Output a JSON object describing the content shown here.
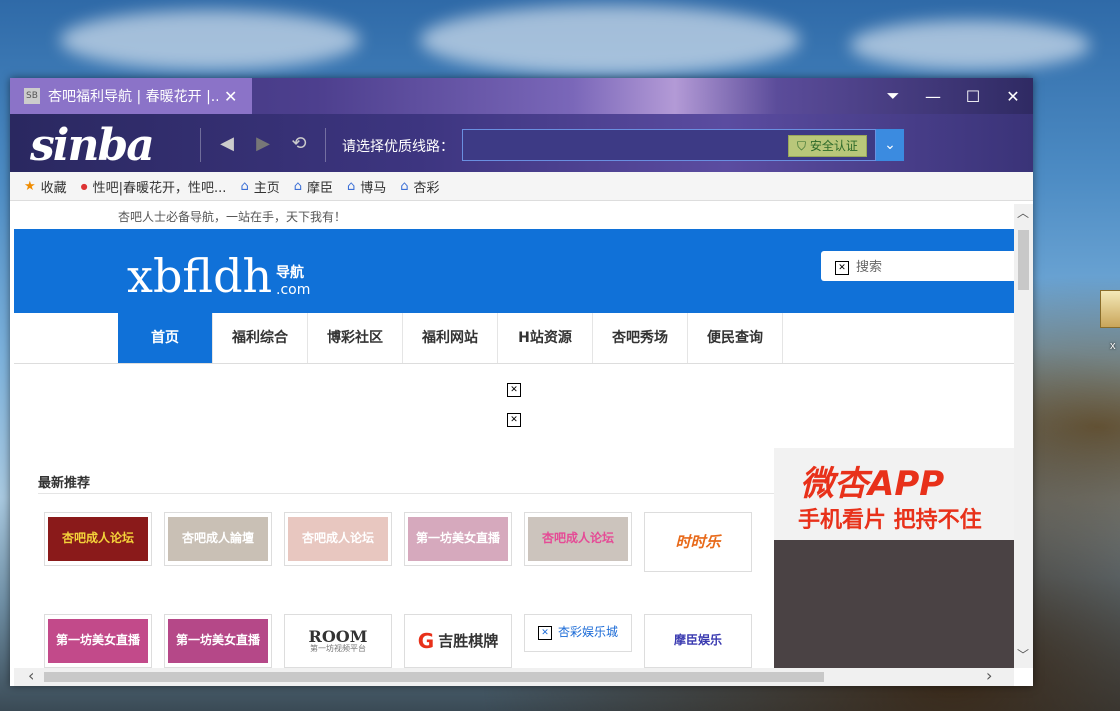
{
  "desktop": {
    "icon_label": "x"
  },
  "tab": {
    "favicon": "SB",
    "title": "杏吧福利导航 | 春暖花开 |...",
    "close": "✕"
  },
  "window_controls": {
    "menu": "⏷",
    "minimize": "—",
    "maximize": "☐",
    "close": "✕"
  },
  "toolbar": {
    "logo": "sinba",
    "back": "◀",
    "forward": "▶",
    "refresh": "⟲",
    "route_label": "请选择优质线路：",
    "route_value": "",
    "secure_label": "安全认证",
    "dropdown": "⌄"
  },
  "bookmarks": [
    {
      "label": "收藏",
      "icon": "star-icon"
    },
    {
      "label": "性吧|春暖花开，性吧...",
      "icon": "site-favicon"
    },
    {
      "label": "主页",
      "icon": "home-icon"
    },
    {
      "label": "摩臣",
      "icon": "home-icon"
    },
    {
      "label": "博马",
      "icon": "home-icon"
    },
    {
      "label": "杏彩",
      "icon": "home-icon"
    }
  ],
  "page": {
    "slogan": "杏吧人士必备导航，一站在手，天下我有！",
    "logo": "xbfldh",
    "logo_sub1": "导航",
    "logo_sub2": ".com",
    "search_placeholder": "搜索",
    "nav": [
      "首页",
      "福利综合",
      "博彩社区",
      "福利网站",
      "H站资源",
      "杏吧秀场",
      "便民查询"
    ],
    "rec_title": "最新推荐",
    "row1": [
      "杏吧成人论坛",
      "杏吧成人論壇",
      "杏吧成人论坛",
      "第一坊美女直播",
      "杏吧成人论坛",
      "时时乐"
    ],
    "row2": [
      "第一坊美女直播",
      "第一坊美女直播",
      "ROOM",
      "吉胜棋牌",
      "杏彩娱乐城",
      "摩臣娱乐"
    ],
    "room_sub": "第一坊视频平台",
    "app_ad_line1": "微杏APP",
    "app_ad_line2": "手机看片 把持不住"
  },
  "scroll": {
    "up": "︿",
    "down": "﹀",
    "left": "‹",
    "right": "›"
  }
}
